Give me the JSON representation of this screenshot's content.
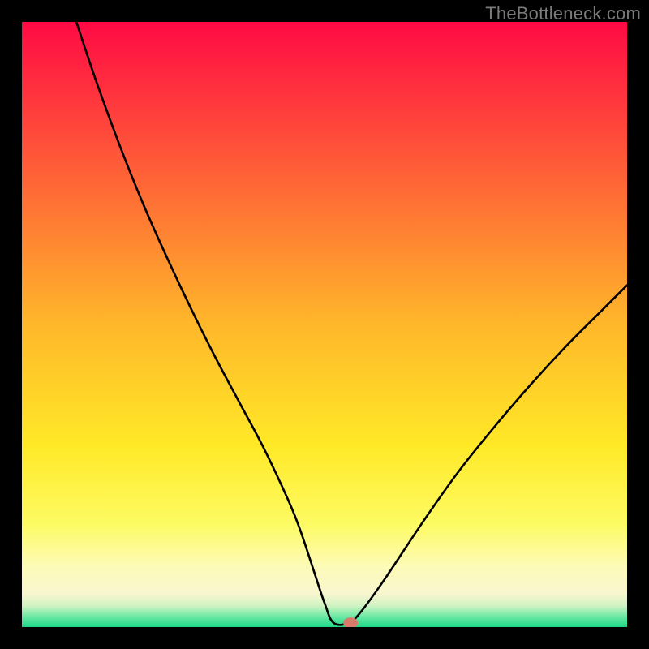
{
  "watermark": "TheBottleneck.com",
  "colors": {
    "page_bg": "#000000",
    "curve_stroke": "#000000",
    "gradient_stops": [
      {
        "offset": 0.0,
        "color": "#ff0a44"
      },
      {
        "offset": 0.5,
        "color": "#ffb72a"
      },
      {
        "offset": 0.7,
        "color": "#ffe927"
      },
      {
        "offset": 0.83,
        "color": "#fdfb63"
      },
      {
        "offset": 0.9,
        "color": "#fdfbb7"
      },
      {
        "offset": 0.945,
        "color": "#f8f6cf"
      },
      {
        "offset": 0.965,
        "color": "#cff3c3"
      },
      {
        "offset": 0.985,
        "color": "#5ee7a0"
      },
      {
        "offset": 1.0,
        "color": "#1fd887"
      }
    ],
    "marker_fill": "#d77a6a"
  },
  "chart_data": {
    "type": "line",
    "title": "",
    "xlabel": "",
    "ylabel": "",
    "xlim": [
      0,
      100
    ],
    "ylim": [
      0,
      100
    ],
    "legend": null,
    "grid": false,
    "series": [
      {
        "name": "bottleneck-curve",
        "x": [
          9,
          12,
          16,
          20,
          24,
          28,
          32,
          36,
          40,
          44,
          46,
          48,
          50,
          51.5,
          54,
          56,
          60,
          66,
          72,
          78,
          84,
          90,
          96,
          100
        ],
        "y": [
          100,
          91,
          80,
          70,
          61,
          52.5,
          44.5,
          37,
          29.5,
          21,
          16,
          10,
          4,
          0.7,
          0.7,
          2.5,
          8,
          17,
          25.5,
          33,
          40,
          46.5,
          52.5,
          56.5
        ]
      }
    ],
    "flat_valley": {
      "x_start": 48.5,
      "x_end": 54.5,
      "y": 0.7
    },
    "marker": {
      "x": 54.3,
      "y": 0.7,
      "rx": 1.2,
      "ry": 0.9
    }
  }
}
